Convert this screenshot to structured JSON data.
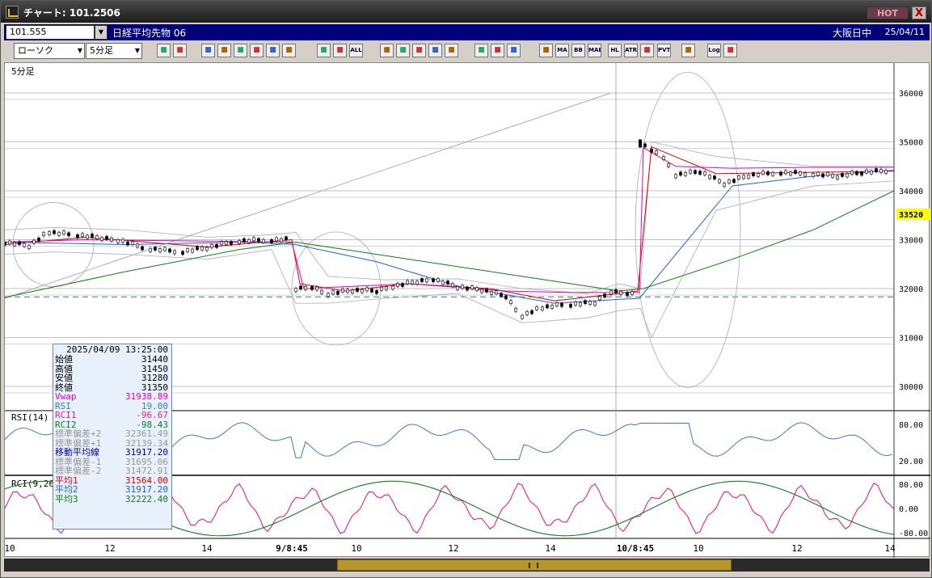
{
  "window": {
    "title": "チャート: 101.2506",
    "hot_label": "HOT",
    "close_label": "X"
  },
  "symbol_bar": {
    "code": "101.555",
    "name": "日経平均先物 06",
    "market_status": "大阪日中",
    "date": "25/04/11"
  },
  "toolbar": {
    "chart_type": "ローソク",
    "timeframe": "5分足",
    "buttons": [
      "search-icon",
      "grid-icon",
      "pen-icon",
      "zoom-icon",
      "cursor-icon",
      "bookmark-icon",
      "document-icon",
      "trash-icon",
      "candle-icon",
      "candle2-icon",
      "ALL",
      "hand-icon",
      "search2-icon",
      "bar-icon",
      "compare-icon",
      "triangle-icon",
      "settings-icon",
      "wrench-icon",
      "palette-icon",
      "indicator-icon",
      "MA",
      "BB",
      "MAE",
      "HL",
      "ATR",
      "env-icon",
      "PVT",
      "frame-icon",
      "Log",
      "export-icon"
    ],
    "labels": {
      "all": "ALL",
      "ma": "MA",
      "bb": "BB",
      "mae": "MAE",
      "hl": "HL",
      "atr": "ATR",
      "pvt": "PVT",
      "log": "Log"
    }
  },
  "colors": {
    "vwap": "#e000c0",
    "ma1": "#e00000",
    "ma2": "#2060e0",
    "ma3": "#108010",
    "rsi": "#3a7ad0",
    "rci1": "#e8207a",
    "rci2": "#108010",
    "current_price_bg": "#ffff00"
  },
  "chart": {
    "timeframe_label": "5分足",
    "price_ticks": [
      "36000",
      "35000",
      "34000",
      "33000",
      "32000",
      "31000",
      "30000"
    ],
    "current_price": "33520",
    "rsi_label": "RSI(14)",
    "rsi_ticks": [
      "80.00",
      "20.00"
    ],
    "rci_label": "RCI(9,26)",
    "rci_ticks": [
      "80.00",
      "0.00",
      "-80.00"
    ],
    "x_ticks": [
      "10",
      "12",
      "14",
      "9/8:45",
      "10",
      "12",
      "14",
      "10/8:45",
      "10",
      "12",
      "14"
    ]
  },
  "infobox": {
    "datetime": "2025/04/09  13:25:00",
    "rows": [
      {
        "label": "始値",
        "value": "31440",
        "color": "#000"
      },
      {
        "label": "高値",
        "value": "31450",
        "color": "#000"
      },
      {
        "label": "安値",
        "value": "31280",
        "color": "#000"
      },
      {
        "label": "終値",
        "value": "31350",
        "color": "#000"
      },
      {
        "label": "Vwap",
        "value": "31938.89",
        "color": "#e000c0"
      },
      {
        "label": "RSI",
        "value": "19.00",
        "color": "#3a7ad0"
      },
      {
        "label": "RCI1",
        "value": "-96.67",
        "color": "#e8207a"
      },
      {
        "label": "RCI2",
        "value": "-98.43",
        "color": "#108010"
      },
      {
        "label": "標準偏差+2",
        "value": "32361.49",
        "color": "#999"
      },
      {
        "label": "標準偏差+1",
        "value": "32139.34",
        "color": "#999"
      },
      {
        "label": "移動平均線",
        "value": "31917.20",
        "color": "#0000a0"
      },
      {
        "label": "標準偏差-1",
        "value": "31695.06",
        "color": "#999"
      },
      {
        "label": "標準偏差-2",
        "value": "31472.91",
        "color": "#999"
      },
      {
        "label": "平均1",
        "value": "31564.00",
        "color": "#e00000"
      },
      {
        "label": "平均2",
        "value": "31917.20",
        "color": "#2060e0"
      },
      {
        "label": "平均3",
        "value": "32222.40",
        "color": "#108010"
      }
    ]
  }
}
